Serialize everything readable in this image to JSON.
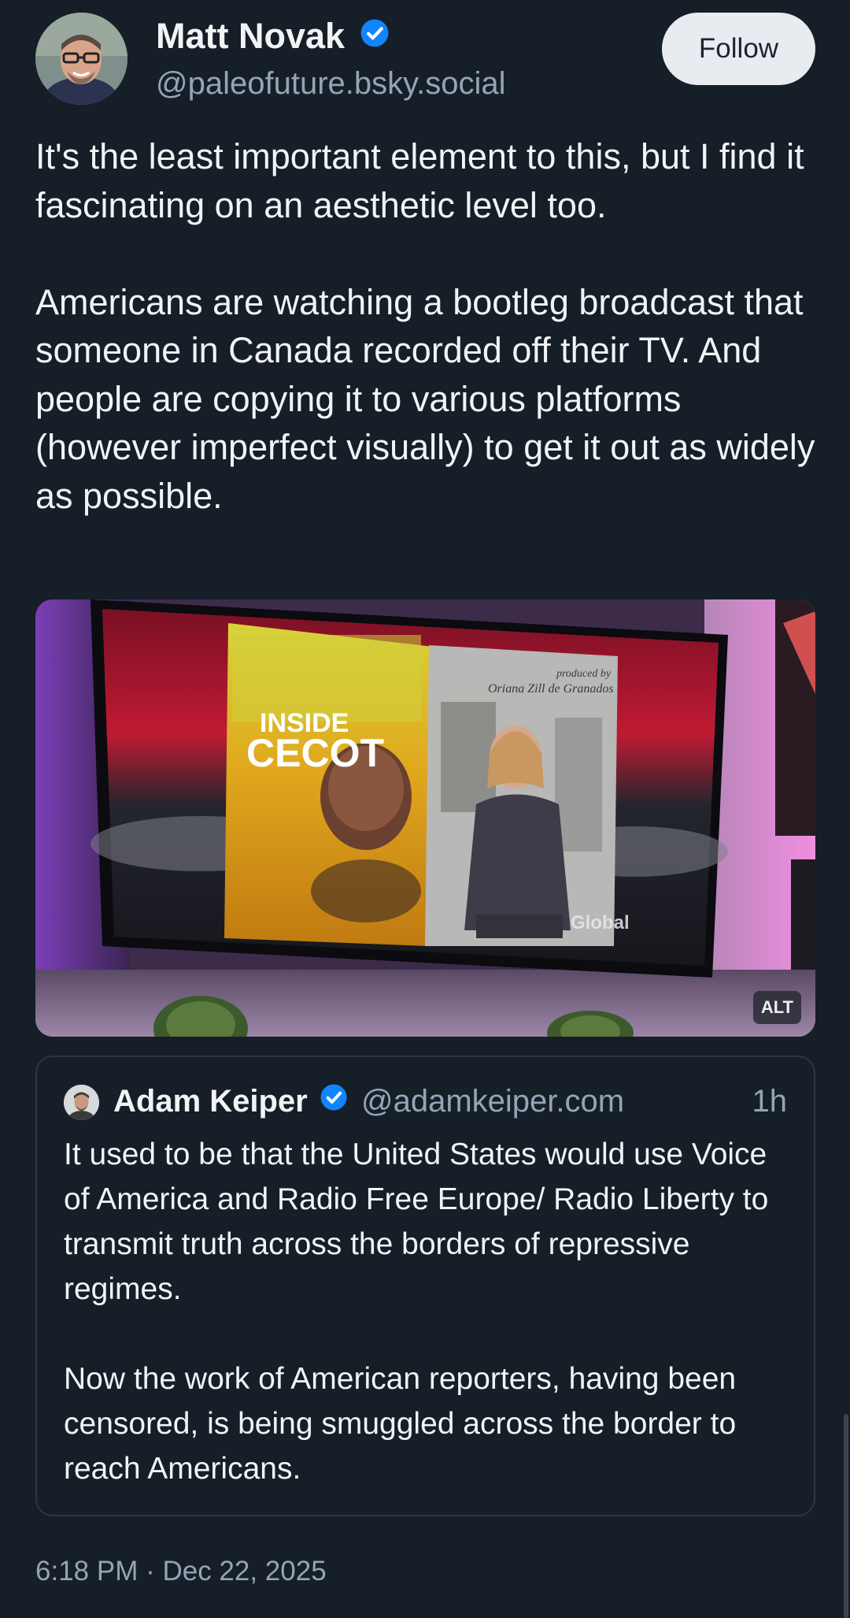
{
  "post": {
    "author_name": "Matt Novak",
    "author_handle": "@paleofuture.bsky.social",
    "follow_label": "Follow",
    "paragraphs": [
      "It's the least important element to this, but I find it fascinating on an aesthetic level too.",
      "Americans are watching a bootleg broadcast that someone in Canada recorded off their TV. And people are copying it to various platforms (however imperfect visually) to get it out as widely as possible."
    ],
    "timestamp": "6:18 PM · Dec 22, 2025"
  },
  "media": {
    "alt_badge": "ALT",
    "tv_title_line1": "INSIDE",
    "tv_title_line2": "CECOT",
    "tv_credit_line1": "produced by",
    "tv_credit_line2": "Oriana Zill de Granados",
    "tv_network": "Global"
  },
  "quote": {
    "author_name": "Adam Keiper",
    "author_handle": "@adamkeiper.com",
    "time": "1h",
    "paragraphs": [
      "It used to be that the United States would use Voice of America and Radio Free Europe/ Radio Liberty to transmit truth across the borders of repressive regimes.",
      "Now the work of American reporters, having been censored, is being smuggled across the border to reach Americans."
    ]
  },
  "colors": {
    "background": "#161e27",
    "text_primary": "#f1f3f5",
    "text_secondary": "#93a5b7",
    "verified": "#1185fe",
    "follow_bg": "#e8ecf0"
  }
}
